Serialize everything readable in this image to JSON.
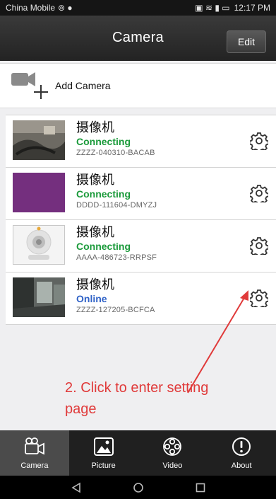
{
  "status_bar": {
    "carrier": "China Mobile",
    "time": "12:17 PM"
  },
  "header": {
    "title": "Camera",
    "edit_label": "Edit"
  },
  "add_camera": {
    "label": "Add Camera"
  },
  "cameras": [
    {
      "name": "摄像机",
      "status": "Connecting",
      "id": "ZZZZ-040310-BACAB"
    },
    {
      "name": "摄像机",
      "status": "Connecting",
      "id": "DDDD-111604-DMYZJ"
    },
    {
      "name": "摄像机",
      "status": "Connecting",
      "id": "AAAA-486723-RRPSF"
    },
    {
      "name": "摄像机",
      "status": "Online",
      "id": "ZZZZ-127205-BCFCA"
    }
  ],
  "annotation": {
    "line1": "2. Click to enter setting",
    "line2": "page"
  },
  "tabs": [
    {
      "label": "Camera",
      "icon": "video-camera-icon"
    },
    {
      "label": "Picture",
      "icon": "picture-icon"
    },
    {
      "label": "Video",
      "icon": "film-reel-icon"
    },
    {
      "label": "About",
      "icon": "info-exclamation-icon"
    }
  ],
  "colors": {
    "connecting": "#1a9a3a",
    "online": "#2f62c7",
    "annotation": "#e03a3a"
  }
}
